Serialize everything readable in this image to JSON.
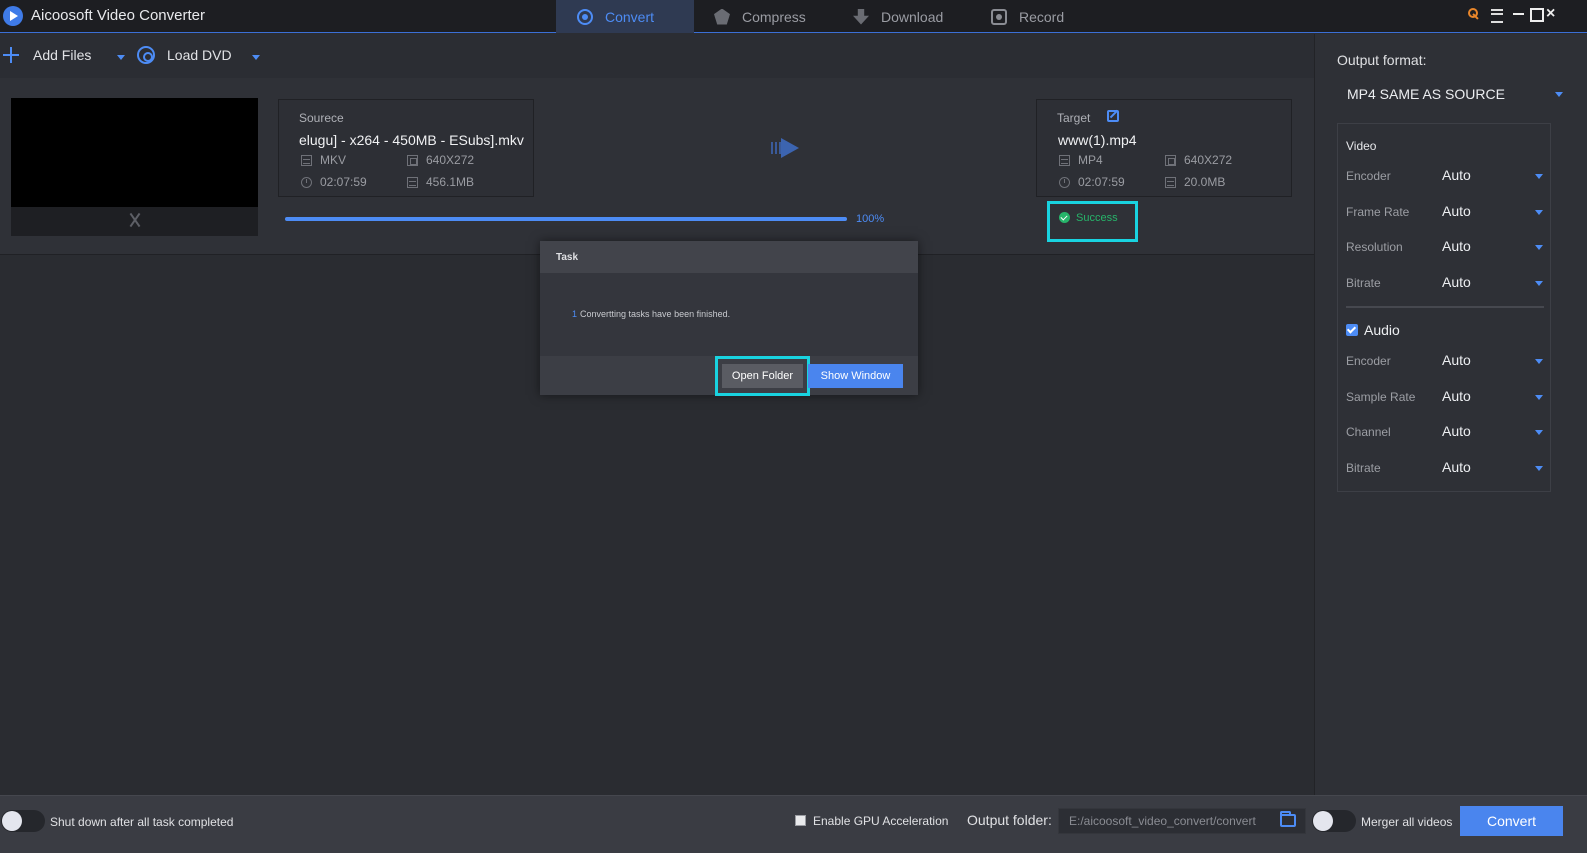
{
  "app": {
    "title": "Aicoosoft Video Converter"
  },
  "tabs": [
    {
      "label": "Convert",
      "active": true
    },
    {
      "label": "Compress"
    },
    {
      "label": "Download"
    },
    {
      "label": "Record"
    }
  ],
  "toolbar": {
    "add_files": "Add Files",
    "load_dvd": "Load DVD"
  },
  "task": {
    "source": {
      "label": "Sourece",
      "filename": "elugu] - x264 - 450MB - ESubs].mkv",
      "format": "MKV",
      "resolution": "640X272",
      "duration": "02:07:59",
      "size": "456.1MB"
    },
    "target": {
      "label": "Target",
      "filename": "www(1).mp4",
      "format": "MP4",
      "resolution": "640X272",
      "duration": "02:07:59",
      "size": "20.0MB"
    },
    "progress": {
      "percent": 100,
      "label": "100%"
    },
    "status": "Success"
  },
  "dialog": {
    "title": "Task",
    "count": "1",
    "message": "Convertting tasks have been finished.",
    "open_folder": "Open Folder",
    "show_window": "Show Window"
  },
  "settings": {
    "output_format_label": "Output format:",
    "output_format": "MP4 SAME AS SOURCE",
    "video": {
      "title": "Video",
      "rows": [
        {
          "label": "Encoder",
          "value": "Auto"
        },
        {
          "label": "Frame Rate",
          "value": "Auto"
        },
        {
          "label": "Resolution",
          "value": "Auto"
        },
        {
          "label": "Bitrate",
          "value": "Auto"
        }
      ]
    },
    "audio": {
      "title": "Audio",
      "checked": true,
      "rows": [
        {
          "label": "Encoder",
          "value": "Auto"
        },
        {
          "label": "Sample Rate",
          "value": "Auto"
        },
        {
          "label": "Channel",
          "value": "Auto"
        },
        {
          "label": "Bitrate",
          "value": "Auto"
        }
      ]
    }
  },
  "bottom": {
    "shutdown_label": "Shut down after all task completed",
    "gpu_label": "Enable GPU Acceleration",
    "output_folder_label": "Output folder:",
    "output_folder_value": "E:/aicoosoft_video_convert/convert",
    "merge_label": "Merger all videos",
    "convert_button": "Convert"
  },
  "colors": {
    "accent": "#4d8cf5",
    "highlight": "#19d3e0",
    "success": "#27b46a"
  }
}
